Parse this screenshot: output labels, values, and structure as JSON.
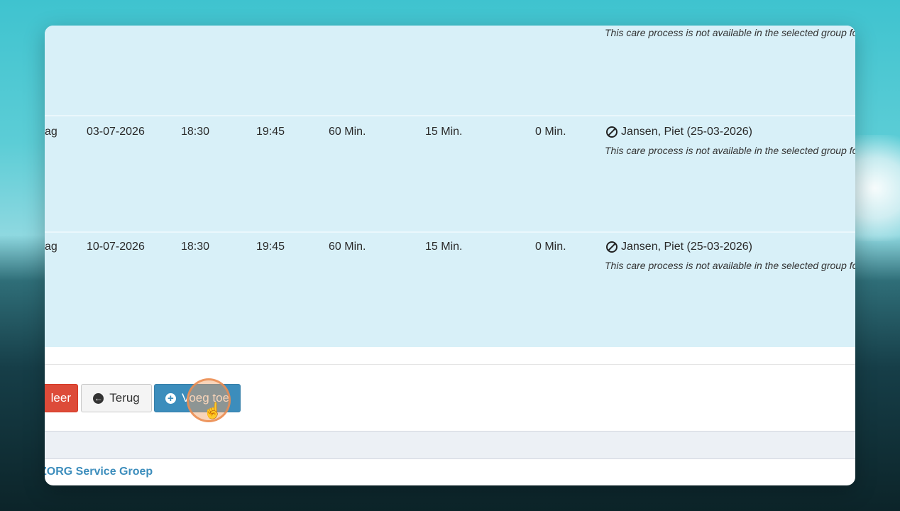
{
  "rows": [
    {
      "note": "This care process is not available in the selected group for t"
    },
    {
      "day": "ag",
      "date": "03-07-2026",
      "start": "18:30",
      "end": "19:45",
      "duration": "60 Min.",
      "travel": "15 Min.",
      "extra": "0 Min.",
      "patient": "Jansen, Piet (25-03-2026)",
      "patient_icon": "ban-icon",
      "note": "This care process is not available in the selected group for t"
    },
    {
      "day": "ag",
      "date": "10-07-2026",
      "start": "18:30",
      "end": "19:45",
      "duration": "60 Min.",
      "travel": "15 Min.",
      "extra": "0 Min.",
      "patient": "Jansen, Piet (25-03-2026)",
      "patient_icon": "ban-icon",
      "note": "This care process is not available in the selected group for t"
    }
  ],
  "buttons": {
    "cancel_label": "leer",
    "back_label": "Terug",
    "back_icon": "arrow-circle-left-icon",
    "add_label": "Voeg toe",
    "add_icon": "plus-circle-icon"
  },
  "footer": {
    "brand": "ZORG Service Groep"
  },
  "colors": {
    "row_bg": "#d8f0f8",
    "danger": "#dd4b39",
    "primary": "#3c8dbc",
    "brand": "#3c8dbc"
  }
}
